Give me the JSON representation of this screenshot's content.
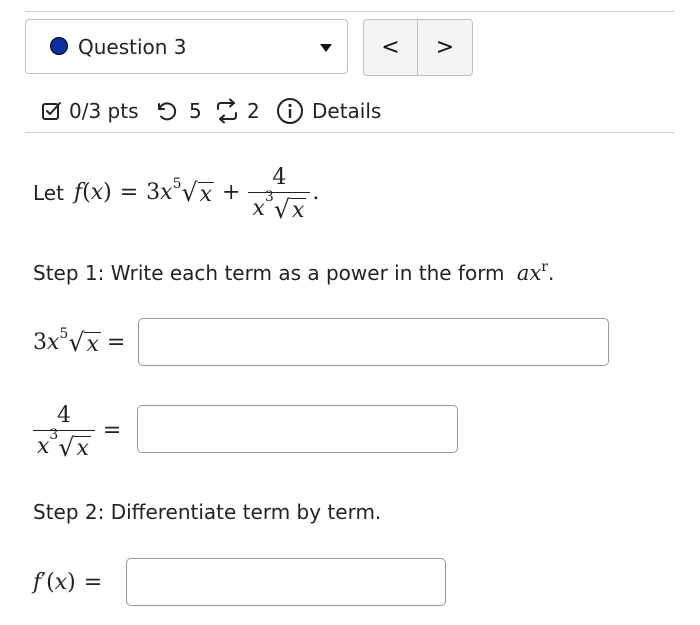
{
  "header": {
    "question_label": "Question 3",
    "prev_glyph": "<",
    "next_glyph": ">",
    "status_dot_color": "#0b2f9e"
  },
  "meta": {
    "score": "0/3 pts",
    "retries": "5",
    "attempts": "2",
    "details": "Details"
  },
  "problem": {
    "intro": "Let",
    "step1": "Step 1: Write each term as a power in the form",
    "step2": "Step 2: Differentiate term by term.",
    "math": {
      "f": "f",
      "x": "x",
      "paren_open": "(",
      "paren_close": ")",
      "eq": "=",
      "plus": "+",
      "three": "3",
      "four": "4",
      "five": "5",
      "cube": "3",
      "a": "a",
      "r": "r",
      "dot": ".",
      "period": ".",
      "prime": "′",
      "radical": "√"
    }
  },
  "inputs": {
    "term1_value": "",
    "term2_value": "",
    "derivative_value": ""
  }
}
